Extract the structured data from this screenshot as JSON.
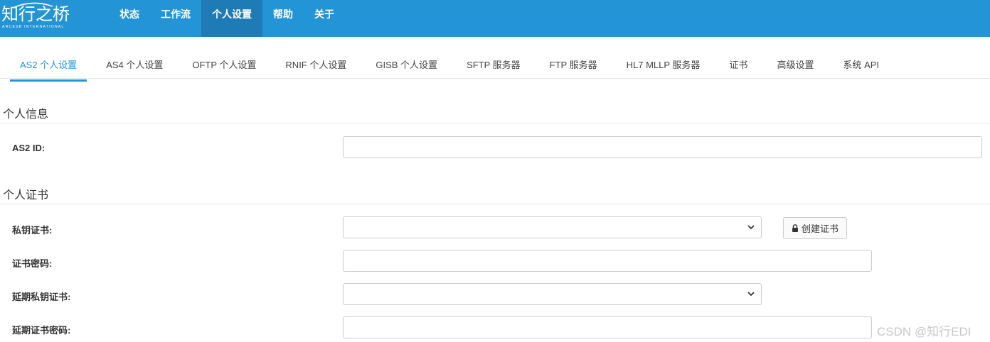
{
  "brand": {
    "logo_text": "知行之桥",
    "logo_subtext": "ARCESB INTERNATIONAL"
  },
  "top_nav": {
    "items": [
      {
        "label": "状态"
      },
      {
        "label": "工作流"
      },
      {
        "label": "个人设置",
        "active": true
      },
      {
        "label": "帮助"
      },
      {
        "label": "关于"
      }
    ]
  },
  "tabs": {
    "items": [
      {
        "label": "AS2 个人设置",
        "active": true
      },
      {
        "label": "AS4 个人设置"
      },
      {
        "label": "OFTP 个人设置"
      },
      {
        "label": "RNIF 个人设置"
      },
      {
        "label": "GISB 个人设置"
      },
      {
        "label": "SFTP 服务器"
      },
      {
        "label": "FTP 服务器"
      },
      {
        "label": "HL7 MLLP 服务器"
      },
      {
        "label": "证书"
      },
      {
        "label": "高级设置"
      },
      {
        "label": "系统 API"
      }
    ]
  },
  "personal_info": {
    "title": "个人信息",
    "as2_id": {
      "label": "AS2 ID:",
      "value": ""
    }
  },
  "personal_cert": {
    "title": "个人证书",
    "private_cert": {
      "label": "私钥证书:",
      "value": ""
    },
    "create_cert_button": "创建证书",
    "cert_password": {
      "label": "证书密码:",
      "value": ""
    },
    "extended_private_cert": {
      "label": "延期私钥证书:",
      "value": ""
    },
    "extended_cert_password": {
      "label": "延期证书密码:",
      "value": ""
    }
  },
  "watermark": "CSDN @知行EDI",
  "colors": {
    "header_bg": "#2394d5",
    "active_nav_bg": "#1f7bb5",
    "active_tab": "#2394d5"
  }
}
